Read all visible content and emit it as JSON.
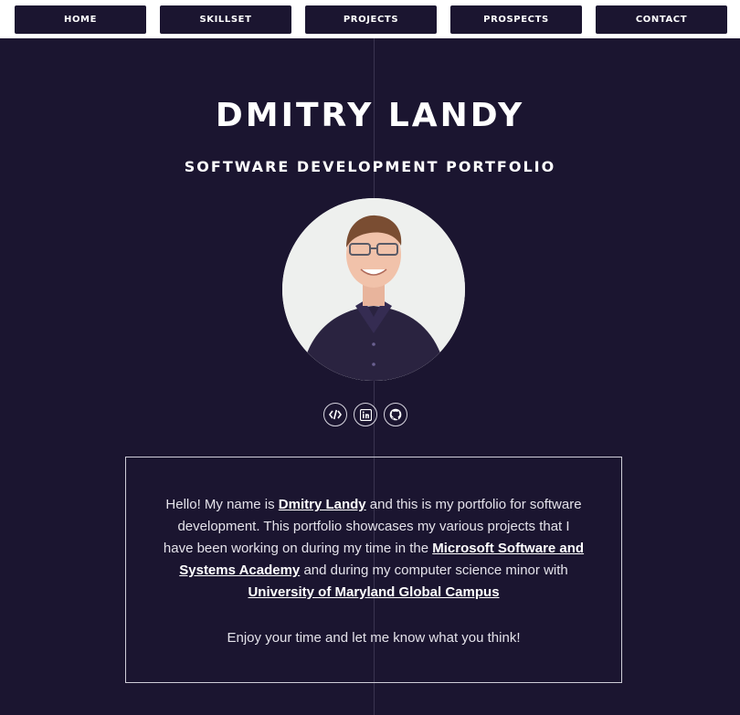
{
  "nav": {
    "home": "HOME",
    "skillset": "SKILLSET",
    "projects": "PROJECTS",
    "prospects": "PROSPECTS",
    "contact": "CONTACT"
  },
  "hero": {
    "title": "DMITRY LANDY",
    "subtitle": "SOFTWARE DEVELOPMENT PORTFOLIO"
  },
  "social": {
    "icons": [
      "code-icon",
      "linkedin-icon",
      "github-icon"
    ]
  },
  "about": {
    "intro": "Hello! My name is ",
    "name_link": "Dmitry Landy",
    "text1": " and this is my portfolio for software development. This portfolio showcases my various projects that I have been working on during my time in the ",
    "msa_link": "Microsoft Software and Systems Academy",
    "text2": " and during my computer science minor with ",
    "umgc_link": "University of Maryland Global Campus",
    "closing": "Enjoy your time and let me know what you think!"
  },
  "colors": {
    "background": "#1b1530",
    "nav_bar": "#ffffff",
    "text": "#ffffff"
  }
}
